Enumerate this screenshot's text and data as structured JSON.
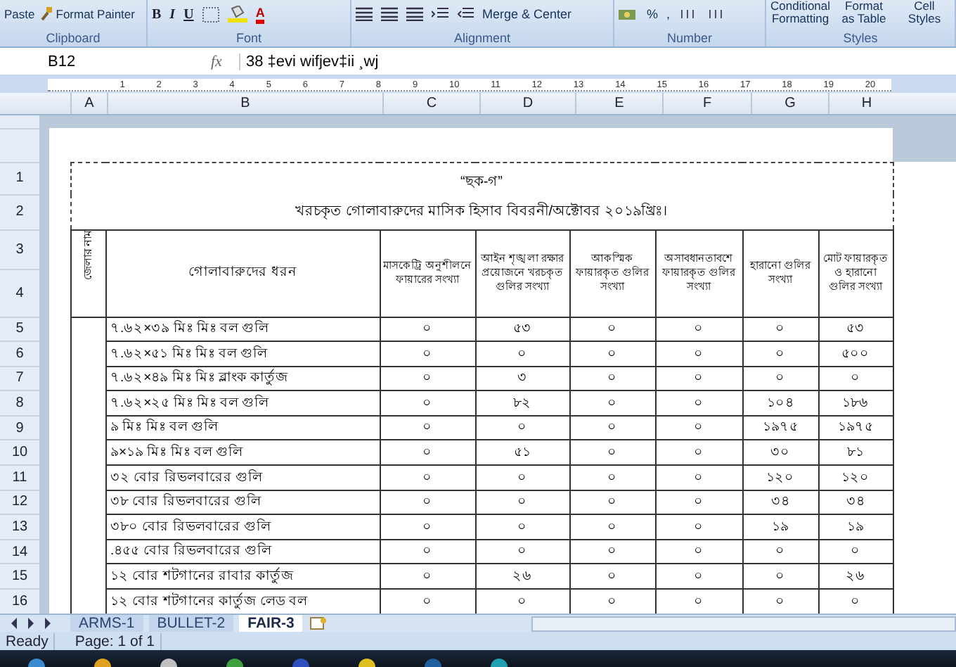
{
  "ribbon": {
    "clipboard": {
      "paste": "Paste",
      "format_painter": "Format Painter",
      "label": "Clipboard"
    },
    "font": {
      "buttons": [
        "B",
        "I",
        "U"
      ],
      "color_letter": "A",
      "label": "Font"
    },
    "alignment": {
      "merge": "Merge & Center",
      "label": "Alignment"
    },
    "number": {
      "percent": "%",
      "comma": ",",
      "label": "Number"
    },
    "styles": {
      "buttons": [
        "Conditional Formatting",
        "Format as Table",
        "Cell Styles"
      ],
      "label": "Styles"
    }
  },
  "formula_bar": {
    "name_box": "B12",
    "fx": "fx",
    "formula": "38 ‡evi wifjev‡ii ¸wj"
  },
  "ruler": [
    "1",
    "2",
    "3",
    "4",
    "5",
    "6",
    "7",
    "8",
    "9",
    "10",
    "11",
    "12",
    "13",
    "14",
    "15",
    "16",
    "17",
    "18",
    "19",
    "20"
  ],
  "column_headers": [
    "A",
    "B",
    "C",
    "D",
    "E",
    "F",
    "G",
    "H"
  ],
  "sheet": {
    "row_numbers": [
      "1",
      "2",
      "3",
      "4",
      "5",
      "6",
      "7",
      "8",
      "9",
      "10",
      "11",
      "12",
      "13",
      "14",
      "15",
      "16"
    ],
    "title": "“ছক-গ”",
    "subtitle": "খরচকৃত গোলাবারুদের মাসিক হিসাব বিবরনী/অক্টোবর ২০১৯খ্রিঃ।",
    "district_header": "জেলার নাম",
    "headers": [
      "গোলাবারুদের ধরন",
      "মাসকেট্রি অনুশীলনে ফায়ারের সংখ্যা",
      "আইন শৃঙ্খলা রক্ষার প্রয়োজনে খরচকৃত গুলির সংখ্যা",
      "আকস্মিক ফায়ারকৃত গুলির সংখ্যা",
      "অসাবধানতাবশে ফায়ারকৃত গুলির সংখ্যা",
      "হারানো গুলির সংখ্যা",
      "মোট ফায়ারকৃত ও হারানো গুলির সংখ্যা"
    ],
    "rows": [
      {
        "cells": [
          "৭.৬২×৩৯ মিঃ মিঃ বল গুলি",
          "০",
          "৫৩",
          "০",
          "০",
          "০",
          "৫৩"
        ]
      },
      {
        "cells": [
          "৭.৬২×৫১ মিঃ মিঃ বল গুলি",
          "০",
          "০",
          "০",
          "০",
          "০",
          "৫০০"
        ]
      },
      {
        "cells": [
          "৭.৬২×৪৯ মিঃ মিঃ ব্লাংক কার্তুজ",
          "০",
          "৩",
          "০",
          "০",
          "০",
          "০"
        ]
      },
      {
        "cells": [
          "৭.৬২×২৫ মিঃ মিঃ বল গুলি",
          "০",
          "৮২",
          "০",
          "০",
          "১০৪",
          "১৮৬"
        ]
      },
      {
        "cells": [
          "৯ মিঃ মিঃ বল গুলি",
          "০",
          "০",
          "০",
          "০",
          "১৯৭৫",
          "১৯৭৫"
        ]
      },
      {
        "cells": [
          "৯×১৯ মিঃ মিঃ বল গুলি",
          "০",
          "৫১",
          "০",
          "০",
          "৩০",
          "৮১"
        ]
      },
      {
        "cells": [
          "৩২ বোর রিভলবারের গুলি",
          "০",
          "০",
          "০",
          "০",
          "১২০",
          "১২০"
        ]
      },
      {
        "cells": [
          "৩৮ বোর রিভলবারের গুলি",
          "০",
          "০",
          "০",
          "০",
          "৩৪",
          "৩৪"
        ]
      },
      {
        "cells": [
          "৩৮০ বোর রিভলবারের গুলি",
          "০",
          "০",
          "০",
          "০",
          "১৯",
          "১৯"
        ]
      },
      {
        "cells": [
          ".৪৫৫ বোর রিভলবারের গুলি",
          "০",
          "০",
          "০",
          "০",
          "০",
          "০"
        ]
      },
      {
        "cells": [
          "১২ বোর শটগানের রাবার কার্তুজ",
          "০",
          "২৬",
          "০",
          "০",
          "০",
          "২৬"
        ]
      },
      {
        "cells": [
          "১২ বোর শটগানের কার্তুজ লেড বল",
          "০",
          "০",
          "০",
          "০",
          "০",
          "০"
        ]
      }
    ]
  },
  "sheet_tabs": [
    {
      "label": "ARMS-1",
      "selected": false
    },
    {
      "label": "BULLET-2",
      "selected": false
    },
    {
      "label": "FAIR-3",
      "selected": true
    }
  ],
  "status_bar": [
    "Ready",
    "Page: 1 of 1"
  ]
}
